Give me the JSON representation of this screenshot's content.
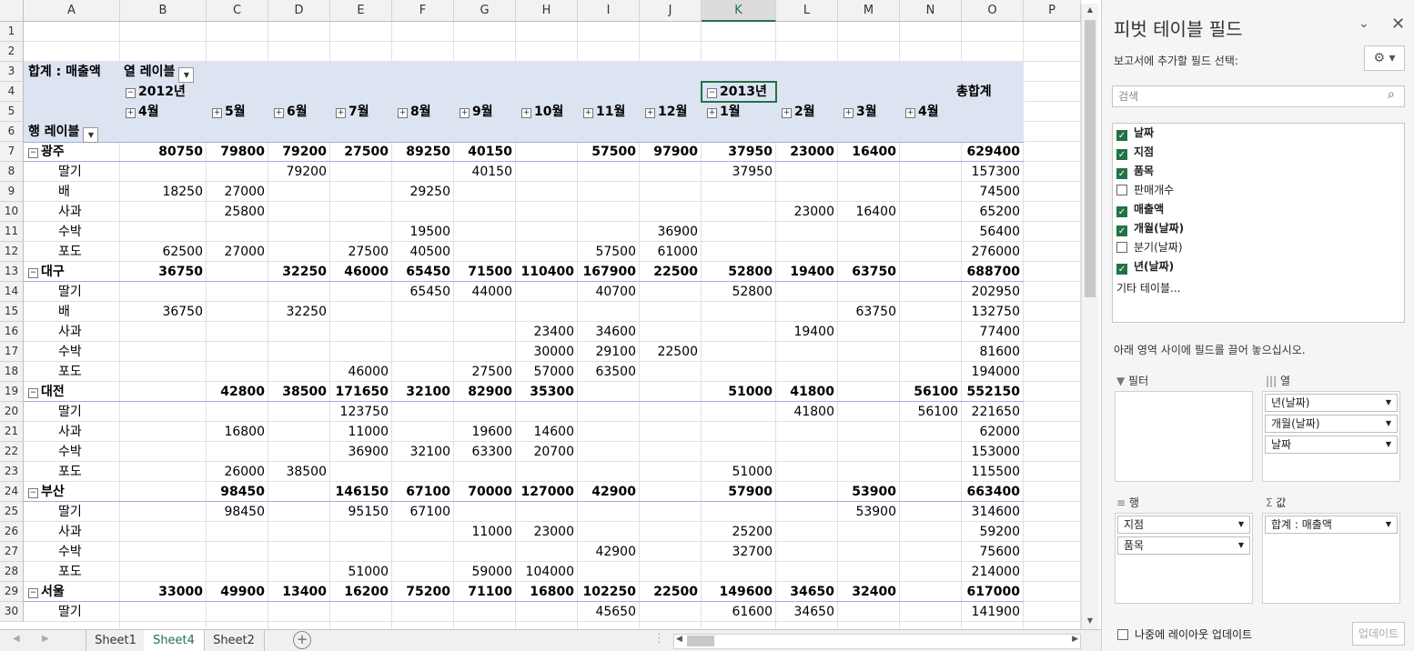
{
  "columns": [
    "A",
    "B",
    "C",
    "D",
    "E",
    "F",
    "G",
    "H",
    "I",
    "J",
    "K",
    "L",
    "M",
    "N",
    "O",
    "P"
  ],
  "rows": [
    "1",
    "2",
    "3",
    "4",
    "5",
    "6",
    "7",
    "8",
    "9",
    "10",
    "11",
    "12",
    "13",
    "14",
    "15",
    "16",
    "17",
    "18",
    "19",
    "20",
    "21",
    "22",
    "23",
    "24",
    "25",
    "26",
    "27",
    "28",
    "29",
    "30"
  ],
  "pivot": {
    "value_label": "합계 : 매출액",
    "col_label": "열 레이블",
    "row_label": "행 레이블",
    "total_label": "총합계",
    "years": [
      "2012년",
      "2013년"
    ],
    "months": [
      "4월",
      "5월",
      "6월",
      "7월",
      "8월",
      "9월",
      "10월",
      "11월",
      "12월",
      "1월",
      "2월",
      "3월",
      "4월"
    ],
    "body": [
      {
        "label": "광주",
        "group": true,
        "values": [
          "80750",
          "79800",
          "79200",
          "27500",
          "89250",
          "40150",
          "",
          "57500",
          "97900",
          "37950",
          "23000",
          "16400",
          "",
          "629400"
        ]
      },
      {
        "label": "딸기",
        "values": [
          "",
          "",
          "79200",
          "",
          "",
          "40150",
          "",
          "",
          "",
          "37950",
          "",
          "",
          "",
          "157300"
        ]
      },
      {
        "label": "배",
        "values": [
          "18250",
          "27000",
          "",
          "",
          "29250",
          "",
          "",
          "",
          "",
          "",
          "",
          "",
          "",
          "74500"
        ]
      },
      {
        "label": "사과",
        "values": [
          "",
          "25800",
          "",
          "",
          "",
          "",
          "",
          "",
          "",
          "",
          "23000",
          "16400",
          "",
          "65200"
        ]
      },
      {
        "label": "수박",
        "values": [
          "",
          "",
          "",
          "",
          "19500",
          "",
          "",
          "",
          "36900",
          "",
          "",
          "",
          "",
          "56400"
        ]
      },
      {
        "label": "포도",
        "values": [
          "62500",
          "27000",
          "",
          "27500",
          "40500",
          "",
          "",
          "57500",
          "61000",
          "",
          "",
          "",
          "",
          "276000"
        ]
      },
      {
        "label": "대구",
        "group": true,
        "values": [
          "36750",
          "",
          "32250",
          "46000",
          "65450",
          "71500",
          "110400",
          "167900",
          "22500",
          "52800",
          "19400",
          "63750",
          "",
          "688700"
        ]
      },
      {
        "label": "딸기",
        "values": [
          "",
          "",
          "",
          "",
          "65450",
          "44000",
          "",
          "40700",
          "",
          "52800",
          "",
          "",
          "",
          "202950"
        ]
      },
      {
        "label": "배",
        "values": [
          "36750",
          "",
          "32250",
          "",
          "",
          "",
          "",
          "",
          "",
          "",
          "",
          "63750",
          "",
          "132750"
        ]
      },
      {
        "label": "사과",
        "values": [
          "",
          "",
          "",
          "",
          "",
          "",
          "23400",
          "34600",
          "",
          "",
          "19400",
          "",
          "",
          "77400"
        ]
      },
      {
        "label": "수박",
        "values": [
          "",
          "",
          "",
          "",
          "",
          "",
          "30000",
          "29100",
          "22500",
          "",
          "",
          "",
          "",
          "81600"
        ]
      },
      {
        "label": "포도",
        "values": [
          "",
          "",
          "",
          "46000",
          "",
          "27500",
          "57000",
          "63500",
          "",
          "",
          "",
          "",
          "",
          "194000"
        ]
      },
      {
        "label": "대전",
        "group": true,
        "values": [
          "",
          "42800",
          "38500",
          "171650",
          "32100",
          "82900",
          "35300",
          "",
          "",
          "51000",
          "41800",
          "",
          "56100",
          "552150"
        ]
      },
      {
        "label": "딸기",
        "values": [
          "",
          "",
          "",
          "123750",
          "",
          "",
          "",
          "",
          "",
          "",
          "41800",
          "",
          "56100",
          "221650"
        ]
      },
      {
        "label": "사과",
        "values": [
          "",
          "16800",
          "",
          "11000",
          "",
          "19600",
          "14600",
          "",
          "",
          "",
          "",
          "",
          "",
          "62000"
        ]
      },
      {
        "label": "수박",
        "values": [
          "",
          "",
          "",
          "36900",
          "32100",
          "63300",
          "20700",
          "",
          "",
          "",
          "",
          "",
          "",
          "153000"
        ]
      },
      {
        "label": "포도",
        "values": [
          "",
          "26000",
          "38500",
          "",
          "",
          "",
          "",
          "",
          "",
          "51000",
          "",
          "",
          "",
          "115500"
        ]
      },
      {
        "label": "부산",
        "group": true,
        "values": [
          "",
          "98450",
          "",
          "146150",
          "67100",
          "70000",
          "127000",
          "42900",
          "",
          "57900",
          "",
          "53900",
          "",
          "663400"
        ]
      },
      {
        "label": "딸기",
        "values": [
          "",
          "98450",
          "",
          "95150",
          "67100",
          "",
          "",
          "",
          "",
          "",
          "",
          "53900",
          "",
          "314600"
        ]
      },
      {
        "label": "사과",
        "values": [
          "",
          "",
          "",
          "",
          "",
          "11000",
          "23000",
          "",
          "",
          "25200",
          "",
          "",
          "",
          "59200"
        ]
      },
      {
        "label": "수박",
        "values": [
          "",
          "",
          "",
          "",
          "",
          "",
          "",
          "42900",
          "",
          "32700",
          "",
          "",
          "",
          "75600"
        ]
      },
      {
        "label": "포도",
        "values": [
          "",
          "",
          "",
          "51000",
          "",
          "59000",
          "104000",
          "",
          "",
          "",
          "",
          "",
          "",
          "214000"
        ]
      },
      {
        "label": "서울",
        "group": true,
        "values": [
          "33000",
          "49900",
          "13400",
          "16200",
          "75200",
          "71100",
          "16800",
          "102250",
          "22500",
          "149600",
          "34650",
          "32400",
          "",
          "617000"
        ]
      },
      {
        "label": "딸기",
        "values": [
          "",
          "",
          "",
          "",
          "",
          "",
          "",
          "45650",
          "",
          "61600",
          "34650",
          "",
          "",
          "141900"
        ]
      }
    ]
  },
  "tabs": [
    "Sheet1",
    "Sheet4",
    "Sheet2"
  ],
  "panel": {
    "title": "피벗 테이블 필드",
    "choose_label": "보고서에 추가할 필드 선택:",
    "search_placeholder": "검색",
    "fields": [
      {
        "label": "날짜",
        "checked": true
      },
      {
        "label": "지점",
        "checked": true
      },
      {
        "label": "품목",
        "checked": true
      },
      {
        "label": "판매개수",
        "checked": false
      },
      {
        "label": "매출액",
        "checked": true
      },
      {
        "label": "개월(날짜)",
        "checked": true
      },
      {
        "label": "분기(날짜)",
        "checked": false
      },
      {
        "label": "년(날짜)",
        "checked": true
      }
    ],
    "more_tables": "기타 테이블...",
    "drag_hint": "아래 영역 사이에 필드를 끌어 놓으십시오.",
    "filter_label": "필터",
    "columns_label": "열",
    "rows_label": "행",
    "values_label": "값",
    "col_fields": [
      "년(날짜)",
      "개월(날짜)",
      "날짜"
    ],
    "row_fields": [
      "지점",
      "품목"
    ],
    "value_fields": [
      "합계 : 매출액"
    ],
    "defer_label": "나중에 레이아웃 업데이트",
    "update_button": "업데이트"
  }
}
